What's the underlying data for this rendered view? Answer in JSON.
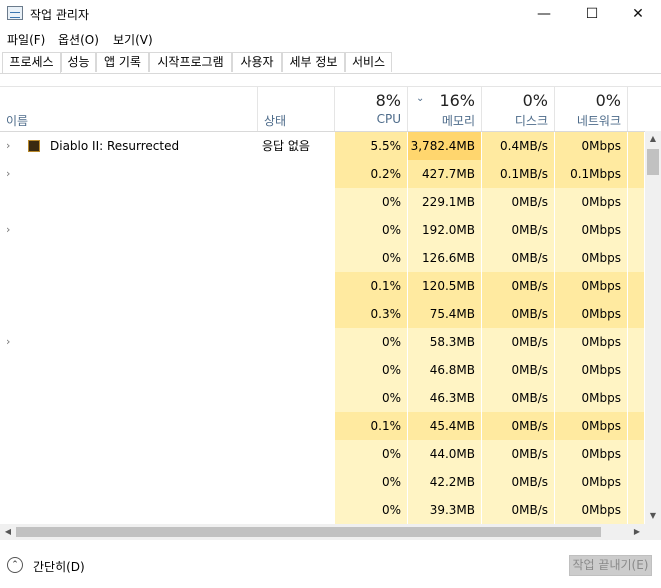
{
  "window": {
    "title": "작업 관리자",
    "minimize_glyph": "—",
    "maximize_glyph": "☐",
    "close_glyph": "✕"
  },
  "menu": [
    "파일(F)",
    "옵션(O)",
    "보기(V)"
  ],
  "tabs": [
    "프로세스",
    "성능",
    "앱 기록",
    "시작프로그램",
    "사용자",
    "세부 정보",
    "서비스"
  ],
  "header": {
    "name_label": "이름",
    "status_label": "상태",
    "sort_glyph": "⌄",
    "cpu": {
      "pct": "8%",
      "label": "CPU"
    },
    "memory": {
      "pct": "16%",
      "label": "메모리"
    },
    "disk": {
      "pct": "0%",
      "label": "디스크"
    },
    "network": {
      "pct": "0%",
      "label": "네트워크"
    }
  },
  "rows": [
    {
      "expander": "›",
      "icon": "diablo-icon",
      "name": "Diablo II: Resurrected",
      "status": "응답 없음",
      "cpu": "5.5%",
      "memory": "3,782.4MB",
      "disk": "0.4MB/s",
      "network": "0Mbps"
    },
    {
      "expander": "›",
      "name": "",
      "status": "",
      "cpu": "0.2%",
      "memory": "427.7MB",
      "disk": "0.1MB/s",
      "network": "0.1Mbps"
    },
    {
      "expander": "",
      "name": "",
      "status": "",
      "cpu": "0%",
      "memory": "229.1MB",
      "disk": "0MB/s",
      "network": "0Mbps"
    },
    {
      "expander": "›",
      "name": "",
      "status": "",
      "cpu": "0%",
      "memory": "192.0MB",
      "disk": "0MB/s",
      "network": "0Mbps"
    },
    {
      "expander": "",
      "name": "",
      "status": "",
      "cpu": "0%",
      "memory": "126.6MB",
      "disk": "0MB/s",
      "network": "0Mbps"
    },
    {
      "expander": "",
      "name": "",
      "status": "",
      "cpu": "0.1%",
      "memory": "120.5MB",
      "disk": "0MB/s",
      "network": "0Mbps"
    },
    {
      "expander": "",
      "name": "",
      "status": "",
      "cpu": "0.3%",
      "memory": "75.4MB",
      "disk": "0MB/s",
      "network": "0Mbps"
    },
    {
      "expander": "›",
      "name": "",
      "status": "",
      "cpu": "0%",
      "memory": "58.3MB",
      "disk": "0MB/s",
      "network": "0Mbps"
    },
    {
      "expander": "",
      "name": "",
      "status": "",
      "cpu": "0%",
      "memory": "46.8MB",
      "disk": "0MB/s",
      "network": "0Mbps"
    },
    {
      "expander": "",
      "name": "",
      "status": "",
      "cpu": "0%",
      "memory": "46.3MB",
      "disk": "0MB/s",
      "network": "0Mbps"
    },
    {
      "expander": "",
      "name": "",
      "status": "",
      "cpu": "0.1%",
      "memory": "45.4MB",
      "disk": "0MB/s",
      "network": "0Mbps"
    },
    {
      "expander": "",
      "name": "",
      "status": "",
      "cpu": "0%",
      "memory": "44.0MB",
      "disk": "0MB/s",
      "network": "0Mbps"
    },
    {
      "expander": "",
      "name": "",
      "status": "",
      "cpu": "0%",
      "memory": "42.2MB",
      "disk": "0MB/s",
      "network": "0Mbps"
    },
    {
      "expander": "",
      "name": "",
      "status": "",
      "cpu": "0%",
      "memory": "39.3MB",
      "disk": "0MB/s",
      "network": "0Mbps"
    }
  ],
  "heat_colors": {
    "light": "#fff4c4",
    "medium": "#ffeaa0",
    "strong": "#ffd66e"
  },
  "footer": {
    "collapse_glyph": "⌃",
    "collapse_label": "간단히(D)",
    "end_task_label": "작업 끝내기(E)"
  },
  "scroll": {
    "up": "▲",
    "down": "▼",
    "left": "◀",
    "right": "▶"
  }
}
